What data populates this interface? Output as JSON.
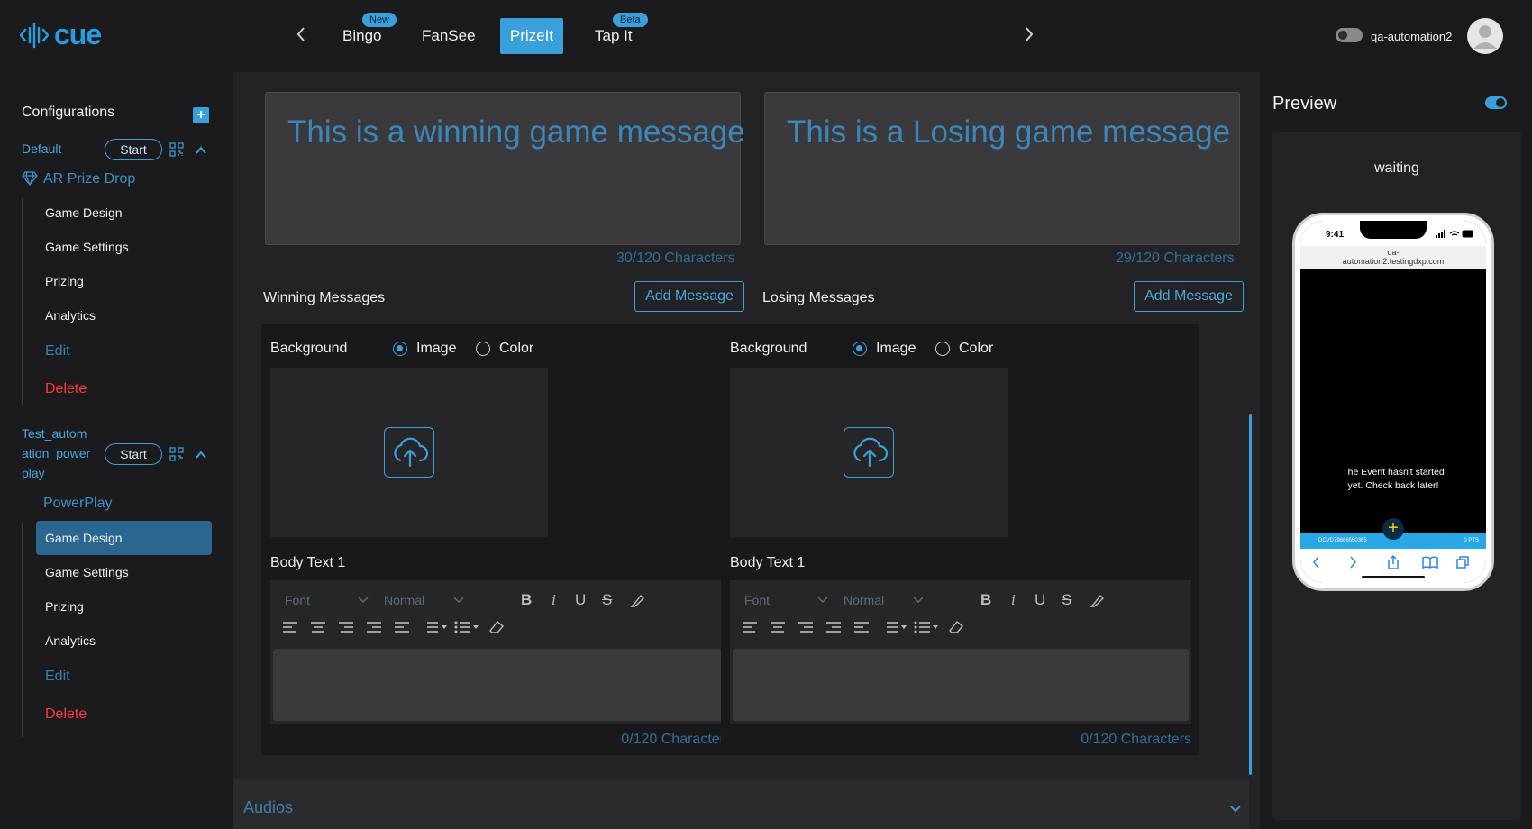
{
  "header": {
    "logo_text": "cue",
    "tabs": [
      {
        "label": "Bingo",
        "badge": "New"
      },
      {
        "label": "FanSee",
        "badge": ""
      },
      {
        "label": "PrizeIt",
        "badge": ""
      },
      {
        "label": "Tap It",
        "badge": "Beta"
      }
    ],
    "active_tab": "PrizeIt",
    "username": "qa-automation2"
  },
  "sidebar": {
    "title": "Configurations",
    "configs": [
      {
        "name": "Default",
        "start_label": "Start",
        "game_type": "AR Prize Drop",
        "items": [
          "Game Design",
          "Game Settings",
          "Prizing",
          "Analytics",
          "Edit",
          "Delete"
        ]
      },
      {
        "name": "Test_autom ation_power play",
        "name_lines": [
          "Test_autom",
          "ation_power",
          "play"
        ],
        "start_label": "Start",
        "game_type": "PowerPlay",
        "items": [
          "Game Design",
          "Game Settings",
          "Prizing",
          "Analytics",
          "Edit",
          "Delete"
        ],
        "active_item": "Game Design"
      }
    ]
  },
  "main": {
    "winning_preview": "This is a winning game message",
    "losing_preview": "This is a Losing game message",
    "winning_count": "30/120 Characters",
    "losing_count": "29/120 Characters",
    "winning_label": "Winning Messages",
    "losing_label": "Losing Messages",
    "add_message_label": "Add Message",
    "background_label": "Background",
    "image_label": "Image",
    "color_label": "Color",
    "background_selected": "Image",
    "body_text_label": "Body Text 1",
    "font_placeholder": "Font",
    "size_placeholder": "Normal",
    "editor_count": "0/120 Characters",
    "audios_label": "Audios"
  },
  "preview": {
    "title": "Preview",
    "status": "waiting",
    "phone": {
      "time": "9:41",
      "url_line1": "qa-",
      "url_line2": "automation2.testingdxp.com",
      "event_message": "The Event hasn't started yet. Check back later!",
      "bar_code": "DCVD79666550365",
      "bar_points": "0 PTS"
    }
  },
  "colors": {
    "accent": "#3aa0dc",
    "danger": "#ff3b3b",
    "background": "#1b1b1d",
    "panel": "#232325"
  }
}
